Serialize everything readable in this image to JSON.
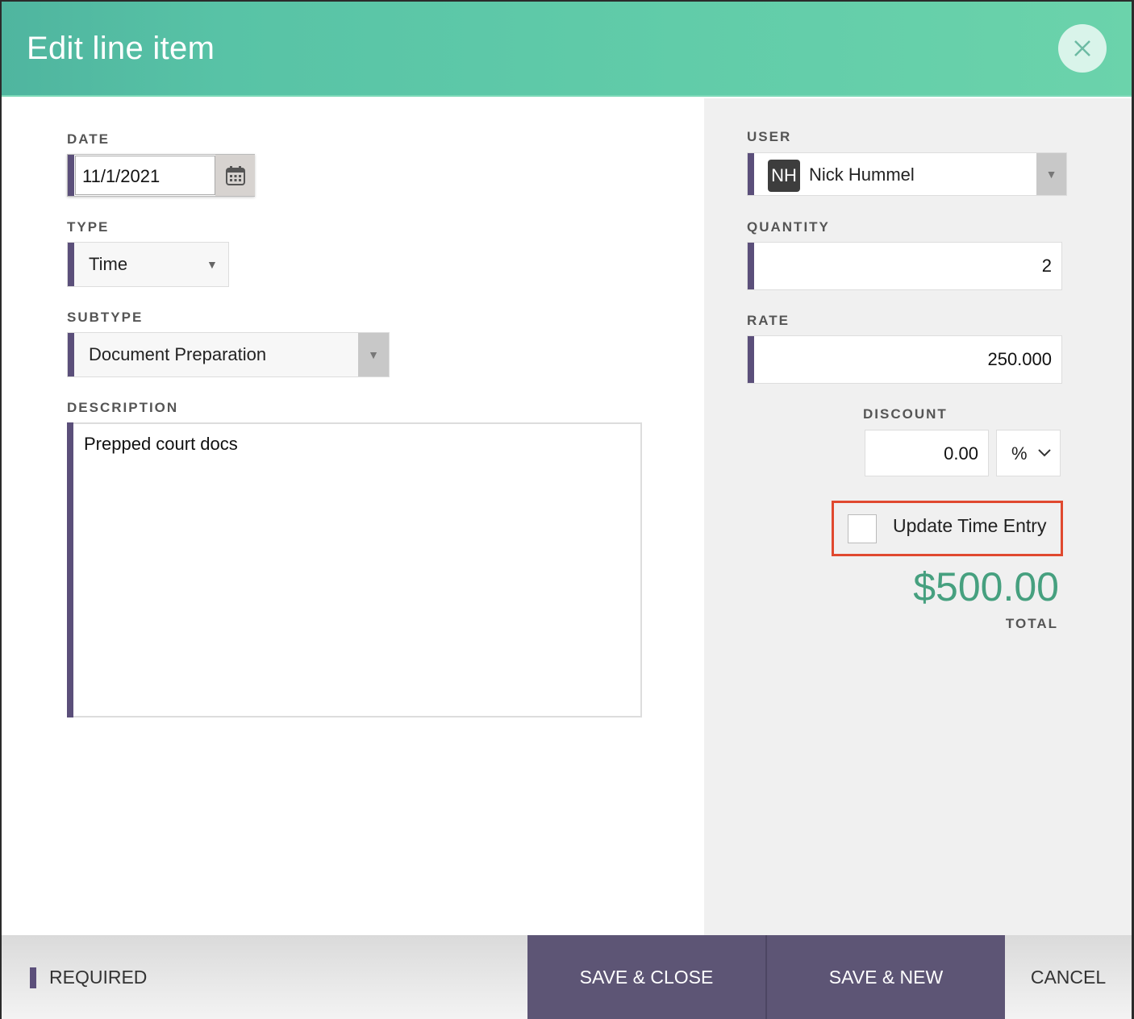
{
  "dialog": {
    "title": "Edit line item",
    "close_icon": "close-icon"
  },
  "left": {
    "date": {
      "label": "DATE",
      "value": "11/1/2021",
      "icon": "calendar-icon"
    },
    "type": {
      "label": "TYPE",
      "value": "Time"
    },
    "subtype": {
      "label": "SUBTYPE",
      "value": "Document Preparation"
    },
    "description": {
      "label": "DESCRIPTION",
      "value": "Prepped court docs"
    }
  },
  "right": {
    "user": {
      "label": "USER",
      "initials": "NH",
      "name": "Nick Hummel"
    },
    "quantity": {
      "label": "QUANTITY",
      "value": "2"
    },
    "rate": {
      "label": "RATE",
      "value": "250.000"
    },
    "discount": {
      "label": "DISCOUNT",
      "value": "0.00",
      "unit": "%"
    },
    "update_time_entry": {
      "label": "Update Time Entry",
      "checked": false
    },
    "total": {
      "amount": "$500.00",
      "label": "TOTAL"
    }
  },
  "footer": {
    "required_label": "REQUIRED",
    "save_close": "SAVE & CLOSE",
    "save_new": "SAVE & NEW",
    "cancel": "CANCEL"
  },
  "colors": {
    "header": "#5fc8a8",
    "accent_required": "#5b4f7a",
    "primary_button": "#5d5575",
    "total": "#46a07f",
    "highlight": "#e0492f"
  }
}
